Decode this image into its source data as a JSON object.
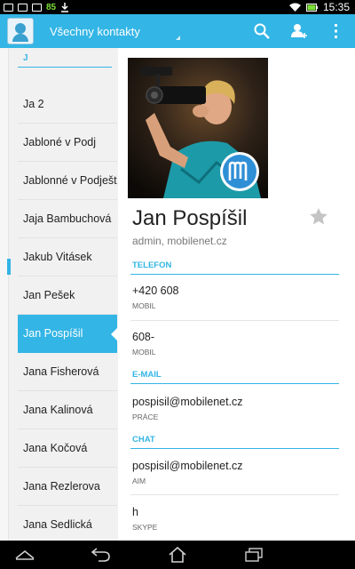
{
  "status_bar": {
    "battery_level": "85",
    "time": "15:35",
    "icons": [
      "notification-icon",
      "photo-icon",
      "download-icon",
      "wifi-icon",
      "battery-icon"
    ]
  },
  "action_bar": {
    "title": "Všechny kontakty",
    "actions": [
      "search-icon",
      "add-contact-icon",
      "overflow-menu-icon"
    ]
  },
  "contact_list": {
    "section_letter": "J",
    "items": [
      {
        "name": "Ja 2"
      },
      {
        "name": "Jabloné v Podj"
      },
      {
        "name": "Jablonné v Podještědí"
      },
      {
        "name": "Jaja Bambuchová"
      },
      {
        "name": "Jakub Vitásek"
      },
      {
        "name": "Jan Pešek"
      },
      {
        "name": "Jan Pospíšil",
        "selected": true
      },
      {
        "name": "Jana Fisherová"
      },
      {
        "name": "Jana Kalinová"
      },
      {
        "name": "Jana Kočová"
      },
      {
        "name": "Jana Rezlerova"
      },
      {
        "name": "Jana Sedlická"
      }
    ]
  },
  "detail": {
    "name": "Jan Pospíšil",
    "subtitle": "admin, mobilenet.cz",
    "sections": [
      {
        "title": "TELEFON",
        "entries": [
          {
            "value": "+420 608",
            "label": "MOBIL"
          },
          {
            "value": "608-",
            "label": "MOBIL"
          }
        ]
      },
      {
        "title": "E-MAIL",
        "entries": [
          {
            "value": "pospisil@mobilenet.cz",
            "label": "PRÁCE"
          }
        ]
      },
      {
        "title": "CHAT",
        "entries": [
          {
            "value": "pospisil@mobilenet.cz",
            "label": "AIM"
          },
          {
            "value": "h",
            "label": "SKYPE"
          }
        ]
      }
    ]
  },
  "colors": {
    "accent": "#33b5e5",
    "list_background": "#f1f1f1",
    "text": "#222222",
    "status_bar": "#000000"
  },
  "nav_bar": {
    "buttons": [
      "recent-apps-up-icon",
      "back-icon",
      "home-icon",
      "recent-apps-icon"
    ]
  }
}
